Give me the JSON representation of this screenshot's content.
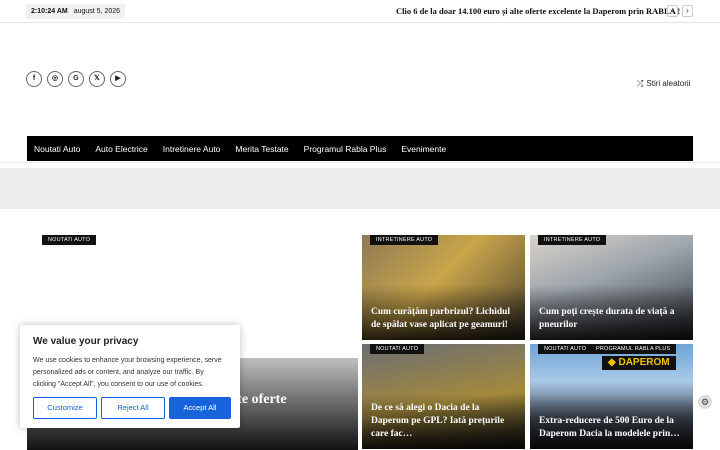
{
  "topbar": {
    "time": "2:10:24 AM",
    "date": "august 5, 2026",
    "ticker": "Clio 6 de la doar 14.100 euro și alte oferte excelente la Daperom prin RABLA !",
    "prev": "‹",
    "next": "›"
  },
  "social": {
    "facebook": "f",
    "instagram": "◎",
    "google": "G",
    "x": "𝕏",
    "youtube": "▶"
  },
  "random": {
    "icon": "⤮",
    "label": "Stiri aleatorii"
  },
  "nav": [
    "Noutati Auto",
    "Auto Electrice",
    "Intretinere Auto",
    "Merita Testate",
    "Programul Rabla Plus",
    "Evenimente"
  ],
  "hero": {
    "badge": "NOUTATI AUTO",
    "title": "Clio 6 de la doar 14.100 euro și alte oferte excelente la Daperom prin…"
  },
  "cards": [
    {
      "badge": "INTRETINERE AUTO",
      "title": "Cum curățăm parbrizul? Lichidul de spălat vase aplicat pe geamuri!"
    },
    {
      "badge": "INTRETINERE AUTO",
      "title": "Cum poți crește durata de viață a pneurilor"
    },
    {
      "badge": "NOUTATI AUTO",
      "title": "De ce să alegi o Dacia de la Daperom pe GPL? Iată prețurile care fac…"
    },
    {
      "badge": "NOUTATI AUTO",
      "badge2": "PROGRAMUL RABLA PLUS",
      "logo": "◆ DAPEROM",
      "title": "Extra-reducere de 500 Euro de la Daperom Dacia la modelele prin…"
    }
  ],
  "cookie": {
    "title": "We value your privacy",
    "text": "We use cookies to enhance your browsing experience, serve personalized ads or content, and analyze our traffic. By clicking \"Accept All\", you consent to our use of cookies.",
    "customize": "Customize",
    "reject": "Reject All",
    "accept": "Accept All"
  },
  "colors": {
    "accent": "#1863dc",
    "nav_bg": "#000000",
    "ad_band": "#ececec"
  }
}
